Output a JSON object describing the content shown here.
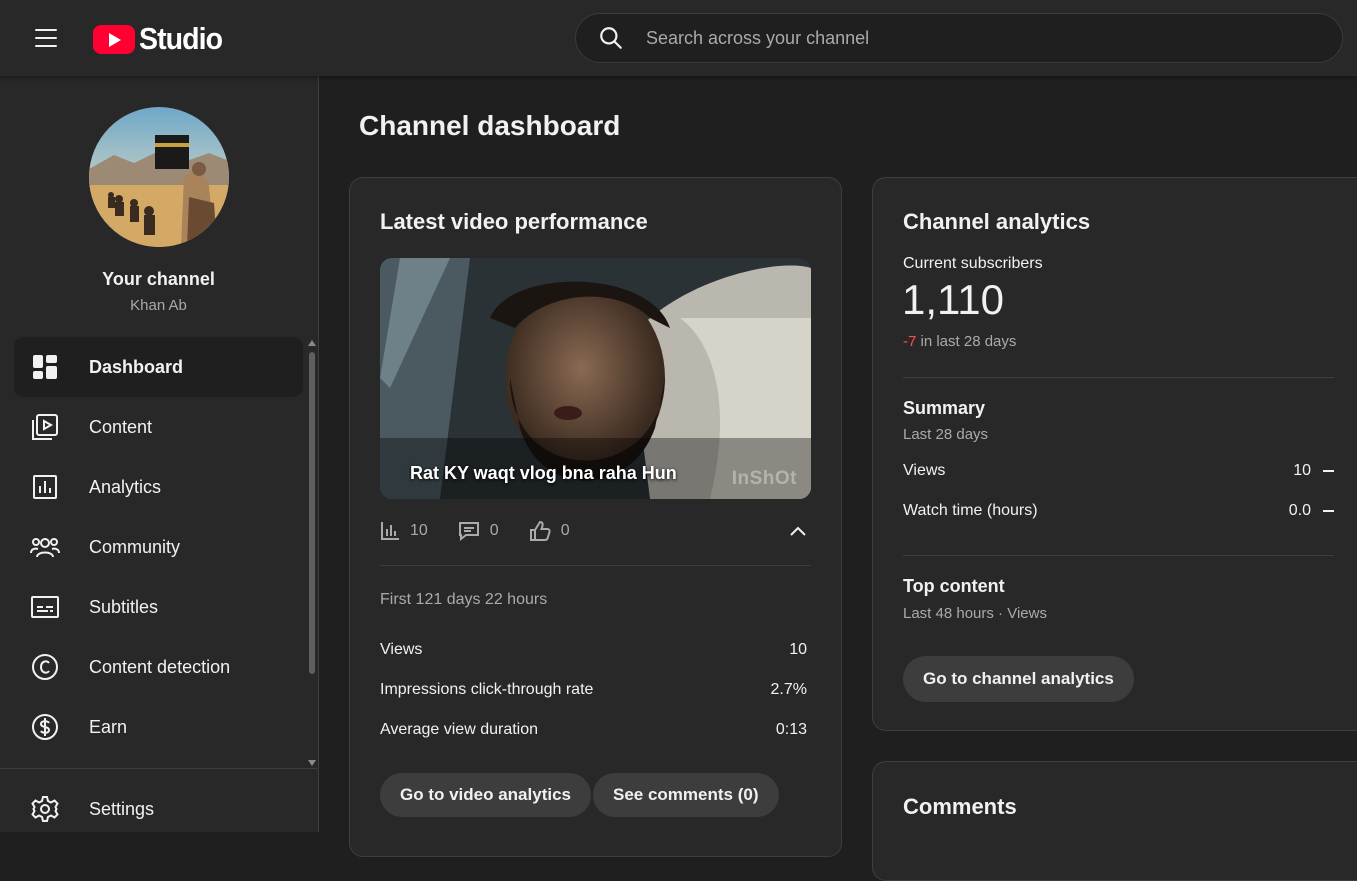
{
  "header": {
    "logo_text": "Studio",
    "search_placeholder": "Search across your channel"
  },
  "sidebar": {
    "channel_title": "Your channel",
    "channel_name": "Khan Ab",
    "items": [
      {
        "label": "Dashboard",
        "icon": "dashboard-icon",
        "active": true
      },
      {
        "label": "Content",
        "icon": "content-icon"
      },
      {
        "label": "Analytics",
        "icon": "analytics-icon"
      },
      {
        "label": "Community",
        "icon": "community-icon"
      },
      {
        "label": "Subtitles",
        "icon": "subtitles-icon"
      },
      {
        "label": "Content detection",
        "icon": "copyright-icon"
      },
      {
        "label": "Earn",
        "icon": "dollar-icon"
      }
    ],
    "settings_label": "Settings"
  },
  "main": {
    "page_title": "Channel dashboard",
    "latest": {
      "title": "Latest video performance",
      "video_title": "Rat KY waqt vlog bna raha Hun",
      "watermark": "InShOt",
      "views_count": "10",
      "comments_count": "0",
      "likes_count": "0",
      "period": "First 121 days 22 hours",
      "metrics": [
        {
          "label": "Views",
          "value": "10"
        },
        {
          "label": "Impressions click-through rate",
          "value": "2.7%"
        },
        {
          "label": "Average view duration",
          "value": "0:13"
        }
      ],
      "analytics_button": "Go to video analytics",
      "comments_button": "See comments (0)"
    },
    "analytics": {
      "title": "Channel analytics",
      "subscribers_label": "Current subscribers",
      "subscribers_count": "1,110",
      "change_value": "-7",
      "change_text": " in last 28 days",
      "summary_title": "Summary",
      "summary_period": "Last 28 days",
      "summary_rows": [
        {
          "label": "Views",
          "value": "10"
        },
        {
          "label": "Watch time (hours)",
          "value": "0.0"
        }
      ],
      "top_content_title": "Top content",
      "top_content_sub": "Last 48 hours · Views",
      "button": "Go to channel analytics"
    },
    "comments": {
      "title": "Comments"
    }
  },
  "colors": {
    "background": "#1f1f1f",
    "surface": "#282828",
    "accent_red": "#ff0033",
    "negative": "#ff4e45"
  }
}
